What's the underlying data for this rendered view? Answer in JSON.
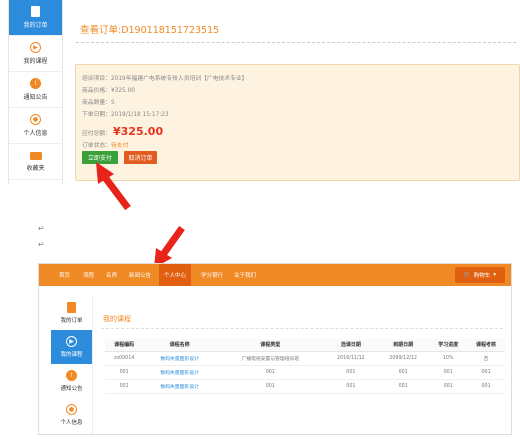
{
  "top": {
    "sidebar": [
      {
        "icon": "document-icon",
        "label": "我的订单"
      },
      {
        "icon": "play-circle-icon",
        "label": "我的课程"
      },
      {
        "icon": "alert-icon",
        "label": "通知公告"
      },
      {
        "icon": "user-icon",
        "label": "个人信息"
      },
      {
        "icon": "folder-icon",
        "label": "收藏夹"
      }
    ],
    "order_title": "查看订单:D190118151723515",
    "details": {
      "training_item": "培训项目：2019年福建广电系统专技人员培训【广电技术专业】",
      "unit_price": "商品价格：¥325.00",
      "quantity": "商品数量：5",
      "order_date": "下单日期：2019/1/18 15:17:23",
      "total_label": "应付总额：",
      "total_value": "¥325.00",
      "status_label": "订单状态：",
      "status_value": "待支付"
    },
    "buttons": {
      "pay": "立即支付",
      "cancel": "取消订单"
    }
  },
  "paragraph_marks": [
    "↵",
    "↵"
  ],
  "bottom": {
    "nav": [
      "首页",
      "流程",
      "名师",
      "新闻公告",
      "个人中心",
      "学分银行",
      "关于我们"
    ],
    "nav_active": "个人中心",
    "cart_label": "购物车",
    "sidebar": [
      {
        "icon": "document-icon",
        "label": "我的订单"
      },
      {
        "icon": "play-circle-icon",
        "label": "我的课程"
      },
      {
        "icon": "alert-icon",
        "label": "通知公告"
      },
      {
        "icon": "user-icon",
        "label": "个人信息"
      }
    ],
    "section_title": "我的课程",
    "table": {
      "headers": [
        "课程编码",
        "课程名称",
        "课程类型",
        "选课日期",
        "到期日期",
        "学习进度",
        "课程考核"
      ],
      "rows": [
        [
          "zs00014",
          "数码失量图形设计",
          "广播电视安置与管理培训班",
          "2016/11/12",
          "2099/12/12",
          "10%",
          "否"
        ],
        [
          "001",
          "数码失量图形设计",
          "001",
          "001",
          "001",
          "001",
          "001"
        ],
        [
          "001",
          "数码失量图形设计",
          "001",
          "001",
          "001",
          "001",
          "001"
        ]
      ]
    }
  },
  "colors": {
    "accent_orange": "#f08a24",
    "active_blue": "#2d8bdc",
    "pay_green": "#3aa13a",
    "cancel_orange": "#e25b1f",
    "price_red": "#e8341c",
    "arrow_red": "#e8231a"
  }
}
